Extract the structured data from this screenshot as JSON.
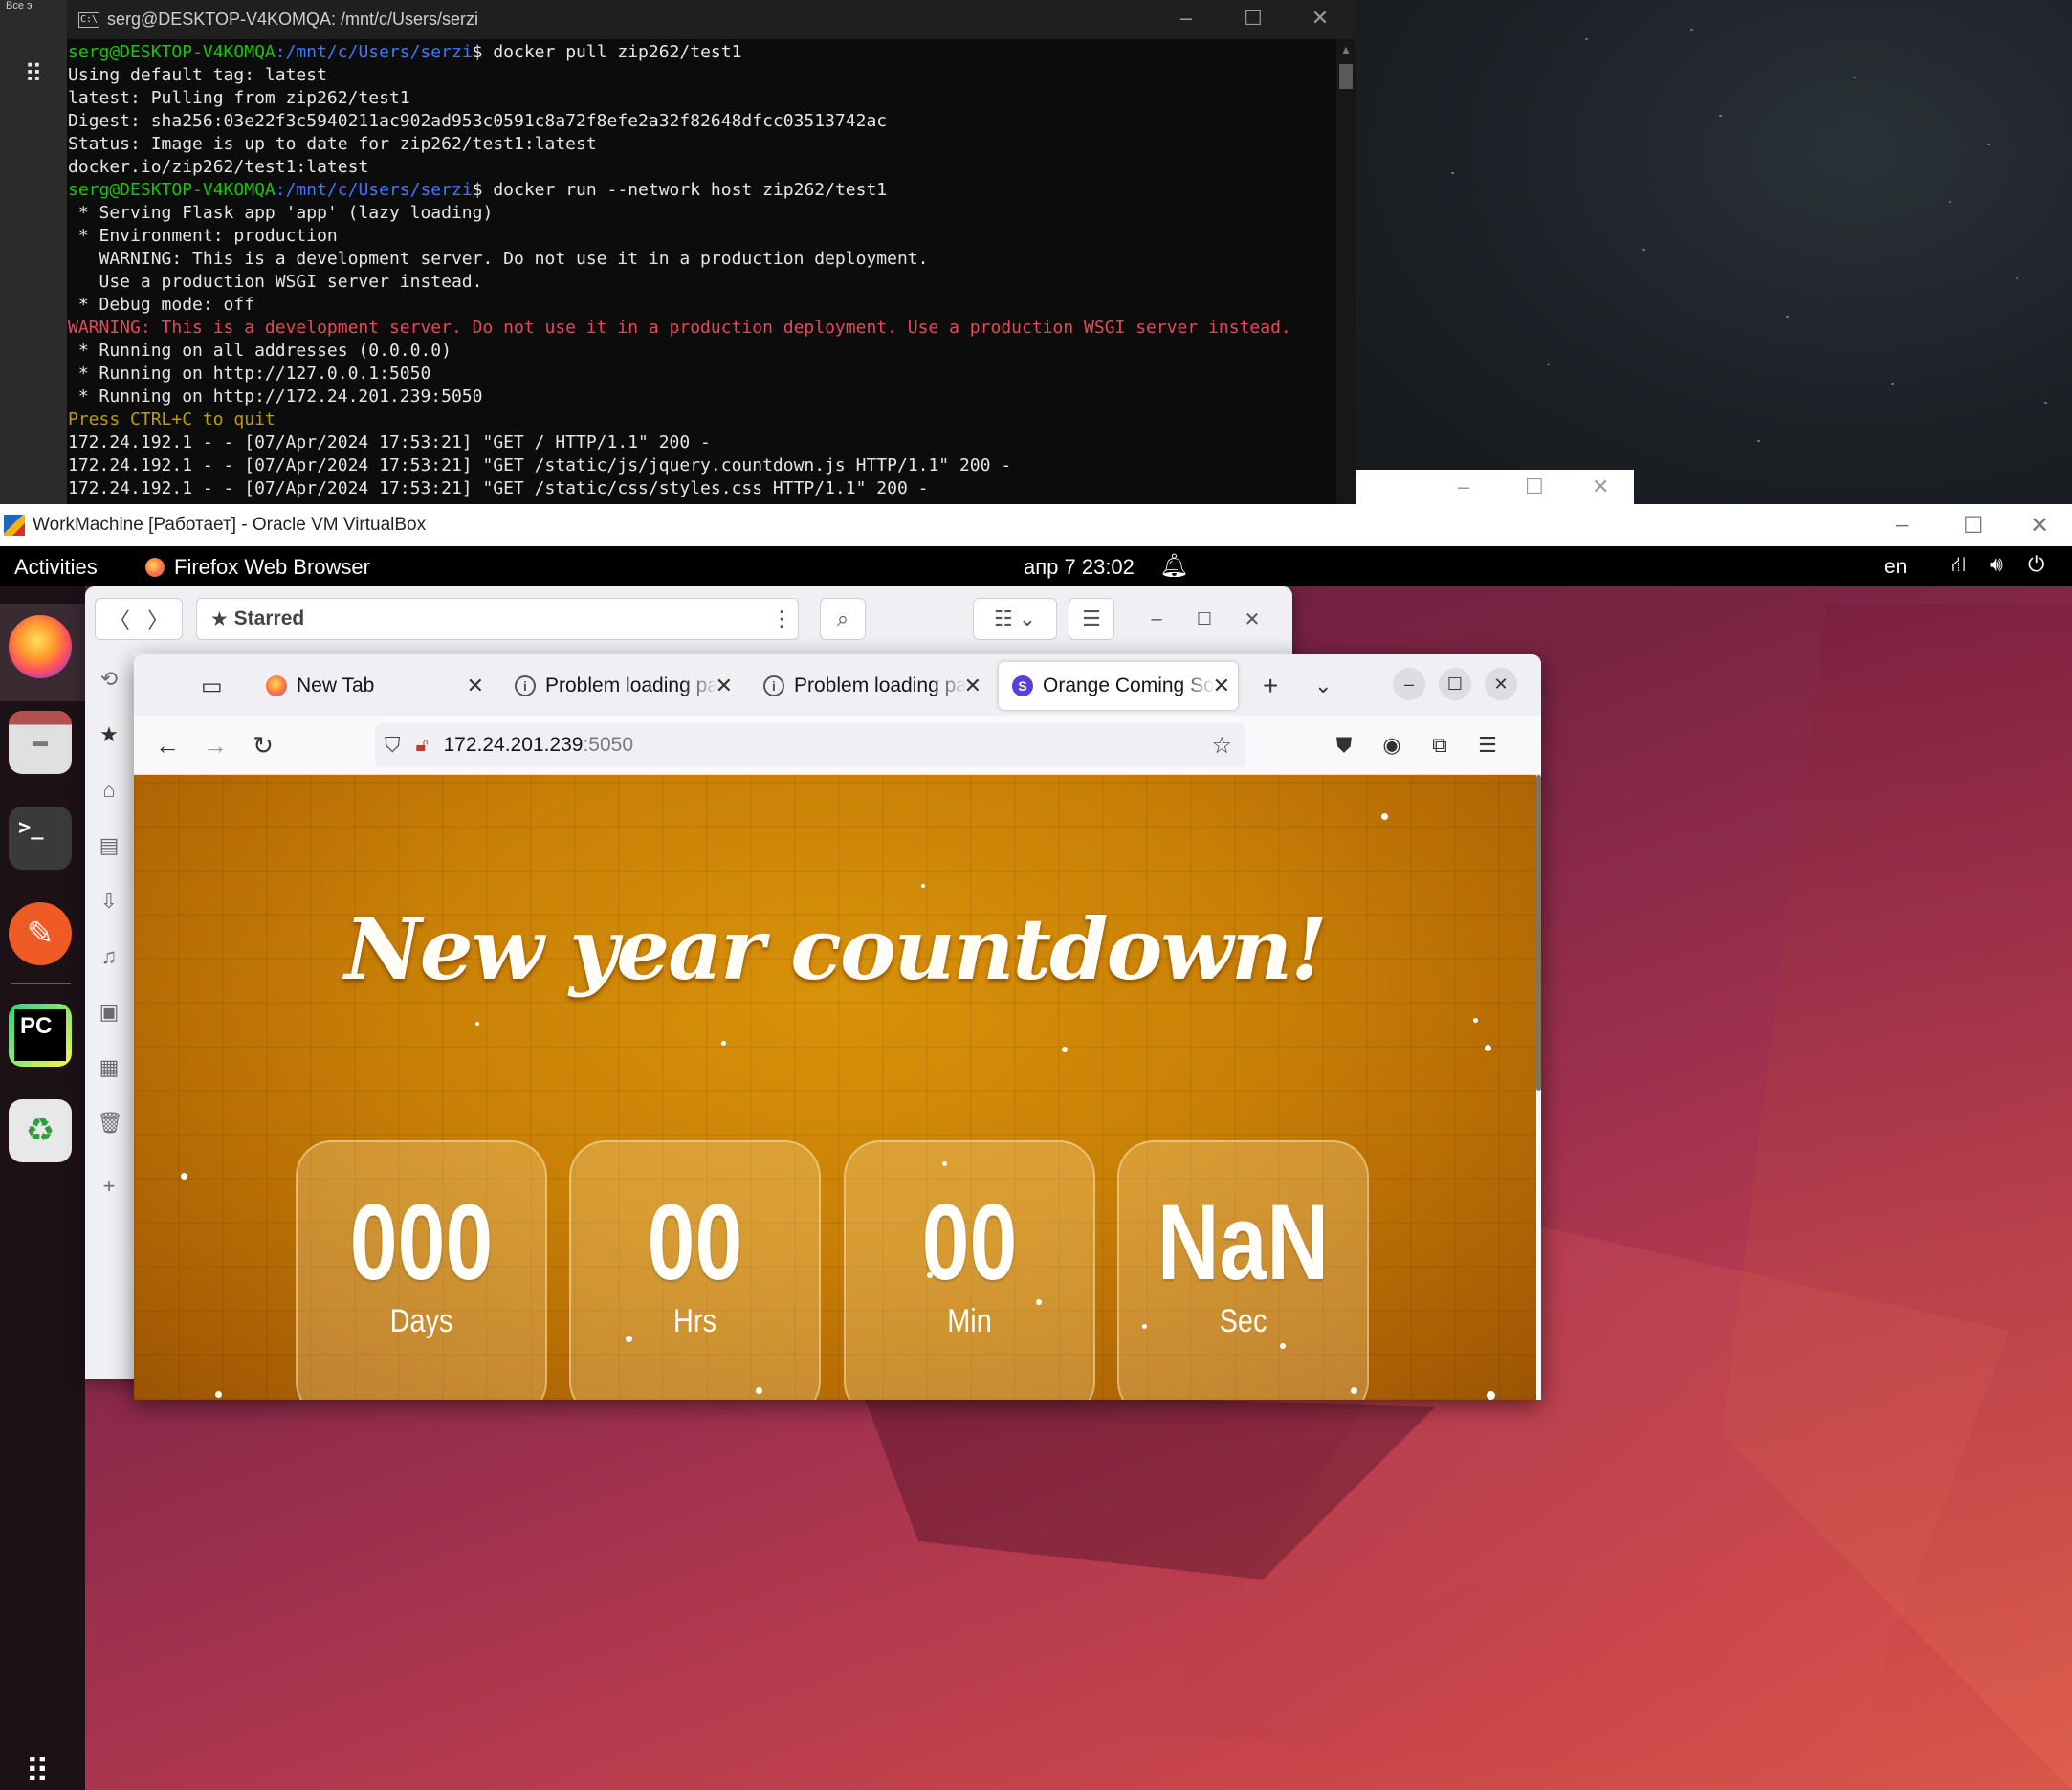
{
  "windows_desktop": {
    "peek_label": "Все э"
  },
  "terminal": {
    "title": "serg@DESKTOP-V4KOMQA: /mnt/c/Users/serzi",
    "prompt_user": "serg@DESKTOP-V4KOMQA",
    "prompt_path": ":/mnt/c/Users/serzi",
    "cmd1": "$ docker pull zip262/test1",
    "out1": "Using default tag: latest",
    "out2": "latest: Pulling from zip262/test1",
    "out3": "Digest: sha256:03e22f3c5940211ac902ad953c0591c8a72f8efe2a32f82648dfcc03513742ac",
    "out4": "Status: Image is up to date for zip262/test1:latest",
    "out5": "docker.io/zip262/test1:latest",
    "cmd2": "$ docker run --network host zip262/test1",
    "out6": " * Serving Flask app 'app' (lazy loading)",
    "out7": " * Environment: production",
    "out8": "   WARNING: This is a development server. Do not use it in a production deployment.",
    "out9": "   Use a production WSGI server instead.",
    "out10": " * Debug mode: off",
    "warn": "WARNING: This is a development server. Do not use it in a production deployment. Use a production WSGI server instead.",
    "out11": " * Running on all addresses (0.0.0.0)",
    "out12": " * Running on http://127.0.0.1:5050",
    "out13": " * Running on http://172.24.201.239:5050",
    "quit": "Press CTRL+C to quit",
    "log1": "172.24.192.1 - - [07/Apr/2024 17:53:21] \"GET / HTTP/1.1\" 200 -",
    "log2": "172.24.192.1 - - [07/Apr/2024 17:53:21] \"GET /static/js/jquery.countdown.js HTTP/1.1\" 200 -",
    "log3": "172.24.192.1 - - [07/Apr/2024 17:53:21] \"GET /static/css/styles.css HTTP/1.1\" 200 -"
  },
  "virtualbox": {
    "title": "WorkMachine [Работает] - Oracle VM VirtualBox"
  },
  "ubuntu_panel": {
    "activities": "Activities",
    "app_name": "Firefox Web Browser",
    "clock": "апр 7  23:02",
    "lang": "en"
  },
  "library_window": {
    "starred_label": "Starred"
  },
  "browser": {
    "tabs": [
      {
        "label": "New Tab"
      },
      {
        "label": "Problem loading page"
      },
      {
        "label": "Problem loading page"
      },
      {
        "label": "Orange Coming Soon"
      }
    ],
    "url_host": "172.24.201.239",
    "url_port": ":5050"
  },
  "countdown": {
    "headline": "New year countdown!",
    "boxes": [
      {
        "value": "000",
        "unit": "Days"
      },
      {
        "value": "00",
        "unit": "Hrs"
      },
      {
        "value": "00",
        "unit": "Min"
      },
      {
        "value": "NaN",
        "unit": "Sec"
      }
    ]
  }
}
